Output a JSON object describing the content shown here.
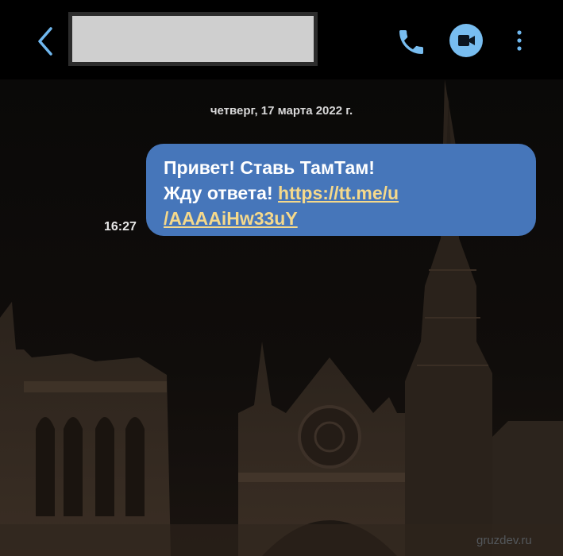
{
  "header": {
    "back_icon": "chevron-left-icon",
    "contact_name_redacted": "",
    "call_icon": "phone-icon",
    "video_icon": "video-camera-icon",
    "menu_icon": "more-vertical-icon",
    "accent_color": "#78bdf0"
  },
  "chat": {
    "date": "четверг, 17 марта 2022 г.",
    "messages": [
      {
        "time": "16:27",
        "line1": "Привет! Ставь ТамТам!",
        "line2_text": "Жду ответа! ",
        "link_part1": "https://tt.me/u",
        "link_part2": "/AAAAiHw33uY",
        "bubble_color": "#4676ba",
        "link_color": "#f5d98b"
      }
    ]
  },
  "watermark": "gruzdev.ru"
}
